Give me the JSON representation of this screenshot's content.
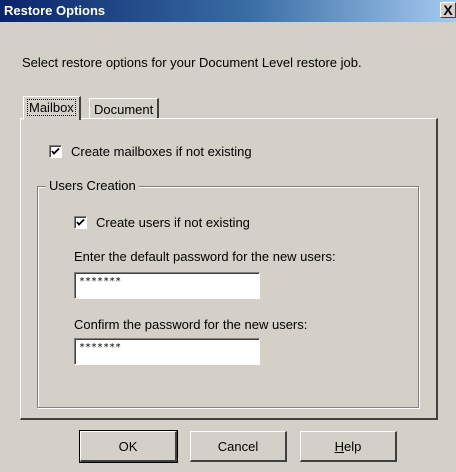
{
  "window": {
    "title": "Restore Options",
    "close_symbol": "X"
  },
  "instruction": "Select restore options for your Document Level restore job.",
  "tabs": [
    {
      "label": "Mailbox",
      "selected": true
    },
    {
      "label": "Document",
      "selected": false
    }
  ],
  "mailbox_tab": {
    "create_mailboxes": {
      "label": "Create mailboxes if not existing",
      "checked": true
    },
    "users_creation": {
      "legend": "Users Creation",
      "create_users": {
        "label": "Create users if not existing",
        "checked": true
      },
      "password_label": "Enter the default password for the new users:",
      "password_value": "*******",
      "confirm_label": "Confirm the password for the new users:",
      "confirm_value": "*******"
    }
  },
  "buttons": {
    "ok": "OK",
    "cancel": "Cancel",
    "help_accel": "H",
    "help_rest": "elp"
  }
}
